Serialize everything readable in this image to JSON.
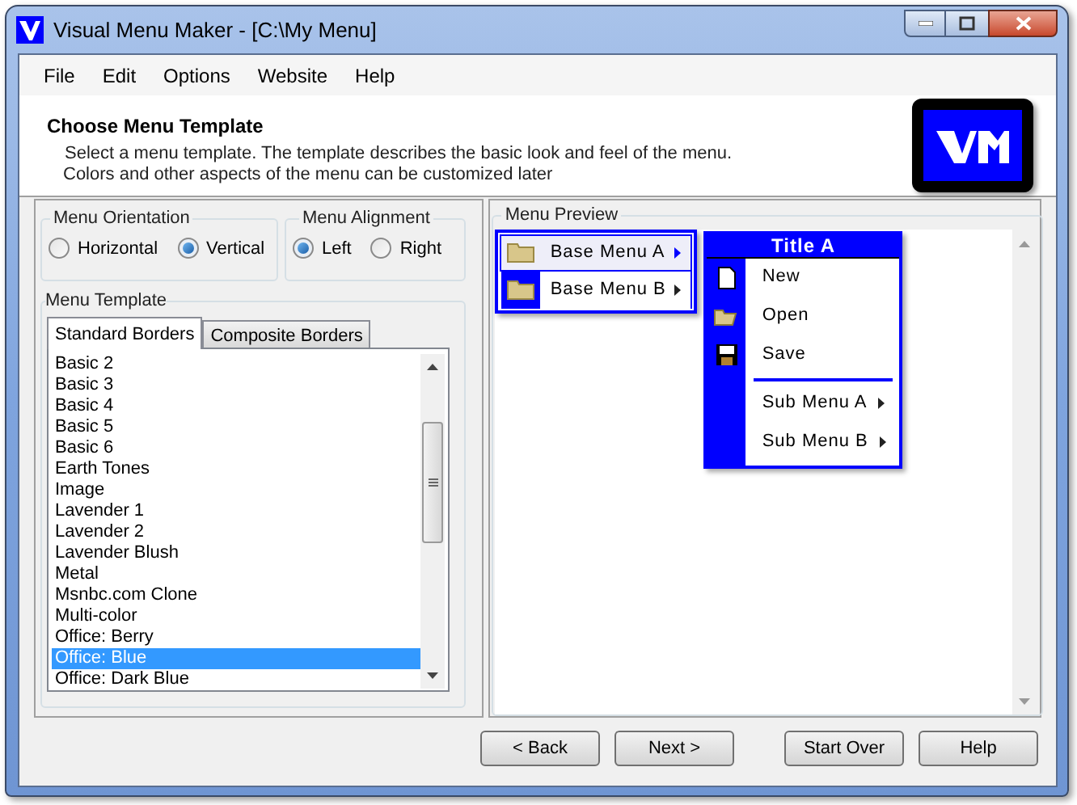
{
  "window": {
    "title": "Visual Menu Maker - [C:\\My Menu]"
  },
  "menu_bar": [
    "File",
    "Edit",
    "Options",
    "Website",
    "Help"
  ],
  "header": {
    "title": "Choose Menu Template",
    "lines": [
      "Select a menu template. The template describes the basic look and feel of the menu.",
      "Colors and other aspects of the menu can be customized later"
    ]
  },
  "orientation": {
    "label": "Menu Orientation",
    "options": [
      {
        "label": "Horizontal",
        "selected": false
      },
      {
        "label": "Vertical",
        "selected": true
      }
    ]
  },
  "alignment": {
    "label": "Menu Alignment",
    "options": [
      {
        "label": "Left",
        "selected": true
      },
      {
        "label": "Right",
        "selected": false
      }
    ]
  },
  "template": {
    "label": "Menu Template",
    "tabs": [
      {
        "label": "Standard Borders",
        "selected": true
      },
      {
        "label": "Composite Borders",
        "selected": false
      }
    ],
    "items": [
      {
        "label": "Basic 2",
        "selected": false
      },
      {
        "label": "Basic 3",
        "selected": false
      },
      {
        "label": "Basic 4",
        "selected": false
      },
      {
        "label": "Basic 5",
        "selected": false
      },
      {
        "label": "Basic 6",
        "selected": false
      },
      {
        "label": "Earth Tones",
        "selected": false
      },
      {
        "label": "Image",
        "selected": false
      },
      {
        "label": "Lavender 1",
        "selected": false
      },
      {
        "label": "Lavender 2",
        "selected": false
      },
      {
        "label": "Lavender Blush",
        "selected": false
      },
      {
        "label": "Metal",
        "selected": false
      },
      {
        "label": "Msnbc.com Clone",
        "selected": false
      },
      {
        "label": "Multi-color",
        "selected": false
      },
      {
        "label": "Office: Berry",
        "selected": false
      },
      {
        "label": "Office: Blue",
        "selected": true
      },
      {
        "label": "Office: Dark Blue",
        "selected": false
      }
    ]
  },
  "preview": {
    "label": "Menu Preview",
    "base_menu": [
      {
        "label": "Base Menu A",
        "selected": true
      },
      {
        "label": "Base Menu B",
        "selected": false
      }
    ],
    "submenu": {
      "title": "Title A",
      "items": [
        {
          "kind": "command",
          "label": "New"
        },
        {
          "kind": "command",
          "label": "Open"
        },
        {
          "kind": "command",
          "label": "Save"
        },
        {
          "kind": "separator"
        },
        {
          "kind": "submenu",
          "label": "Sub Menu A"
        },
        {
          "kind": "submenu",
          "label": "Sub Menu B"
        }
      ]
    }
  },
  "buttons": [
    "< Back",
    "Next >",
    "Start Over",
    "Help"
  ]
}
